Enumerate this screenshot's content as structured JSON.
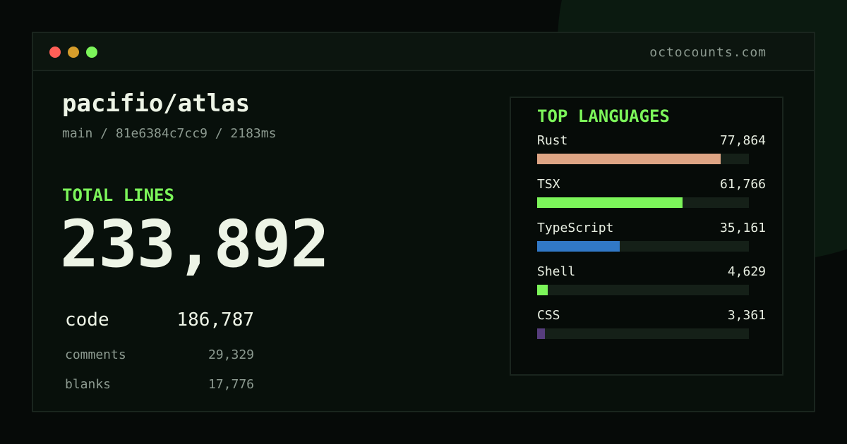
{
  "window": {
    "domain": "octocounts.com"
  },
  "repo": {
    "name": "pacifio/atlas",
    "meta": "main / 81e6384c7cc9 / 2183ms"
  },
  "totals": {
    "label": "TOTAL LINES",
    "value": "233,892",
    "code_label": "code",
    "code_value": "186,787",
    "comments_label": "comments",
    "comments_value": "29,329",
    "blanks_label": "blanks",
    "blanks_value": "17,776"
  },
  "languages": {
    "title": "TOP LANGUAGES",
    "items": [
      {
        "name": "Rust",
        "count": "77,864",
        "share": 0.867,
        "color": "#dea584"
      },
      {
        "name": "TSX",
        "count": "61,766",
        "share": 0.687,
        "color": "#7cf55a"
      },
      {
        "name": "TypeScript",
        "count": "35,161",
        "share": 0.39,
        "color": "#3178c6"
      },
      {
        "name": "Shell",
        "count": "4,629",
        "share": 0.05,
        "color": "#7cf55a"
      },
      {
        "name": "CSS",
        "count": "3,361",
        "share": 0.037,
        "color": "#563d7c"
      }
    ]
  }
}
